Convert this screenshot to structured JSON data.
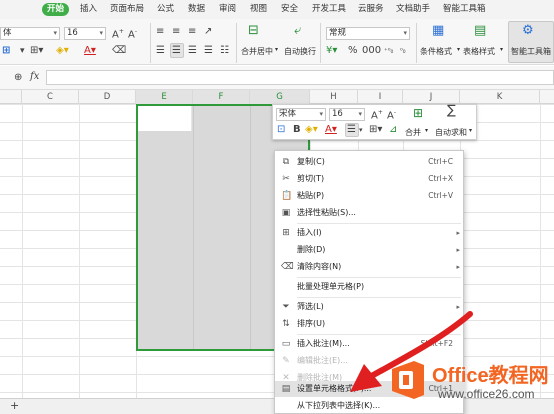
{
  "tabs": [
    "开始",
    "插入",
    "页面布局",
    "公式",
    "数据",
    "审阅",
    "视图",
    "安全",
    "开发工具",
    "云服务",
    "文档助手",
    "智能工具箱"
  ],
  "ribbon": {
    "font_name": "体",
    "font_size": "16",
    "number_format": "常规",
    "merge_label": "合并居中",
    "wrap_label": "自动换行",
    "cond_format_label": "条件格式",
    "table_style_label": "表格样式",
    "smart_toolbox_label": "智能工具箱"
  },
  "formula_bar": {
    "name_box": "",
    "fx": "fx",
    "value": ""
  },
  "columns": [
    "C",
    "D",
    "E",
    "F",
    "G",
    "H",
    "I",
    "J",
    "K"
  ],
  "mini_toolbar": {
    "font_name": "宋体",
    "font_size": "16",
    "merge_label": "合并",
    "autosum_label": "自动求和"
  },
  "context_menu": {
    "items": [
      {
        "icon": "copy-icon",
        "label": "复制(C)",
        "shortcut": "Ctrl+C"
      },
      {
        "icon": "cut-icon",
        "label": "剪切(T)",
        "shortcut": "Ctrl+X"
      },
      {
        "icon": "paste-icon",
        "label": "粘贴(P)",
        "shortcut": "Ctrl+V"
      },
      {
        "icon": "paste-special-icon",
        "label": "选择性粘贴(S)...",
        "shortcut": ""
      },
      {
        "icon": "insert-icon",
        "label": "插入(I)",
        "shortcut": ""
      },
      {
        "icon": "",
        "label": "删除(D)",
        "shortcut": ""
      },
      {
        "icon": "clear-icon",
        "label": "清除内容(N)",
        "shortcut": ""
      },
      {
        "icon": "",
        "label": "批量处理单元格(P)",
        "shortcut": ""
      },
      {
        "icon": "filter-icon",
        "label": "筛选(L)",
        "shortcut": ""
      },
      {
        "icon": "sort-icon",
        "label": "排序(U)",
        "shortcut": ""
      },
      {
        "icon": "comment-icon",
        "label": "插入批注(M)...",
        "shortcut": "Shift+F2"
      },
      {
        "icon": "edit-comment-icon",
        "label": "编辑批注(E)...",
        "shortcut": ""
      },
      {
        "icon": "delete-comment-icon",
        "label": "删除批注(M)",
        "shortcut": ""
      },
      {
        "icon": "format-cells-icon",
        "label": "设置单元格格式(F)...",
        "shortcut": "Ctrl+1"
      },
      {
        "icon": "",
        "label": "从下拉列表中选择(K)...",
        "shortcut": ""
      }
    ]
  },
  "sheet_bar": {
    "add": "+"
  },
  "watermark": {
    "brand": "Office教程网",
    "url": "www.office26.com"
  },
  "colors": {
    "accent": "#2f9a3a",
    "arrow": "#e02020",
    "logo": "#f26522"
  }
}
